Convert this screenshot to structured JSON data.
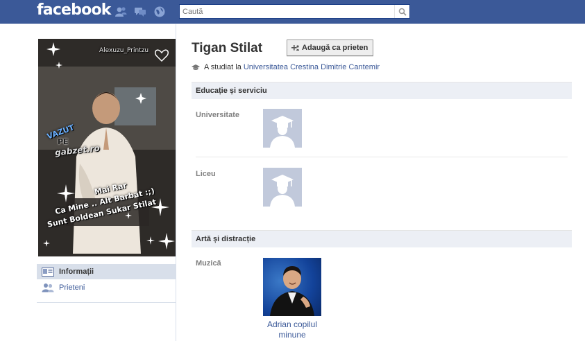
{
  "topbar": {
    "logo": "facebook",
    "jewels": [
      "friend-requests-icon",
      "messages-icon",
      "notifications-icon"
    ],
    "search_placeholder": "Caută"
  },
  "profile_picture": {
    "overlay_name": "Alexuzu_Printzu",
    "overlay_vazut": "VAZUT",
    "overlay_pe": "PE",
    "overlay_site": "gabzet.ro",
    "overlay_quote_1": "Mai Rar",
    "overlay_quote_2": "Ca Mine .. Alt Barbat :;)",
    "overlay_quote_3": "Sunt Boldean Sukar Stilat"
  },
  "left_nav": {
    "info_label": "Informații",
    "friends_label": "Prieteni"
  },
  "profile": {
    "name": "Tigan Stilat",
    "add_friend_label": "Adaugă ca prieten",
    "studied_prefix": "A studiat la",
    "studied_school": "Universitatea Crestina Dimitrie Cantemir"
  },
  "sections": {
    "education_title": "Educație și serviciu",
    "university_label": "Universitate",
    "highschool_label": "Liceu",
    "arts_title": "Artă și distracție",
    "music_label": "Muzică",
    "music_item": "Adrian copilul minune"
  },
  "colors": {
    "brand": "#3b5998",
    "section_bg": "#eceff5"
  }
}
